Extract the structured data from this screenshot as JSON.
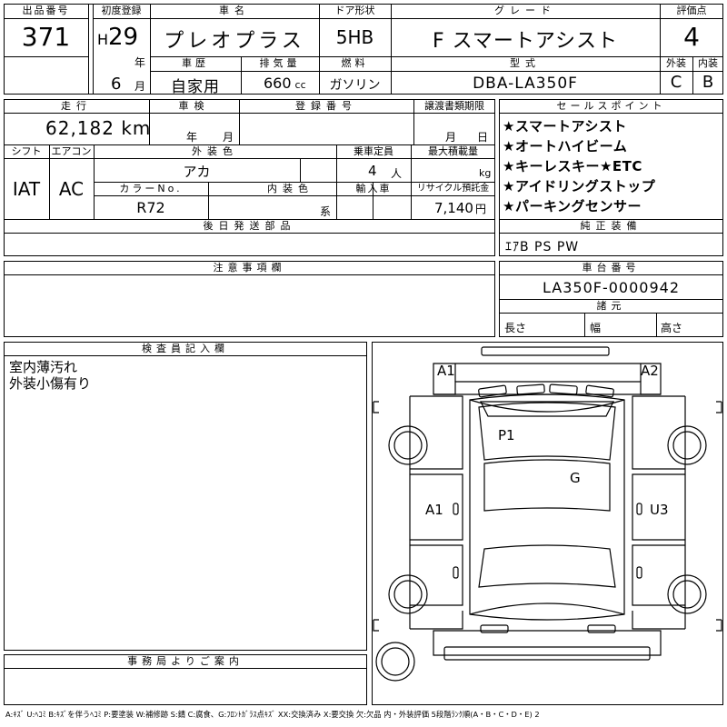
{
  "header": {
    "lot_label": "出品番号",
    "lot_no": "371",
    "reg_label": "初度登録",
    "era": "H",
    "year": "29",
    "year_unit": "年",
    "month": "6",
    "month_unit": "月",
    "name_label": "車名",
    "car_name": "プレオプラス",
    "door_label": "ドア形状",
    "door_type": "5HB",
    "grade_label": "グレード",
    "grade": "F スマートアシスト",
    "score_label": "評価点",
    "score": "4",
    "history_label": "車歴",
    "history": "自家用",
    "disp_label": "排気量",
    "displacement": "660",
    "disp_unit": "cc",
    "fuel_label": "燃料",
    "fuel": "ガソリン",
    "model_label": "型式",
    "model": "DBA-LA350F",
    "ext_label": "外装",
    "ext_grade": "C",
    "int_label": "内装",
    "int_grade": "B"
  },
  "row2": {
    "mileage_label": "走行",
    "mileage": "62,182",
    "mileage_unit": "km",
    "inspect_label": "車検",
    "inspect_year_unit": "年",
    "inspect_month_unit": "月",
    "regno_label": "登録番号",
    "transfer_label": "譲渡書類期限",
    "transfer_month_unit": "月",
    "transfer_day_unit": "日",
    "shift_label": "シフト",
    "shift": "IAT",
    "ac_label": "エアコン",
    "ac": "AC",
    "extcolor_label": "外装色",
    "ext_color": "アカ",
    "seats_label": "乗車定員",
    "seats": "4",
    "seats_unit": "人",
    "load_label": "最大積載量",
    "load_unit": "kg",
    "colorno_label": "カラーNo.",
    "color_no": "R72",
    "intcolor_label": "内装色",
    "int_color_unit": "系",
    "import_label": "輸入車",
    "recycle_label": "リサイクル預託金",
    "recycle": "7,140",
    "recycle_unit": "円",
    "later_parts_label": "後日発送部品"
  },
  "sales_points": {
    "label": "セールスポイント",
    "items": [
      "★スマートアシスト",
      "★オートハイビーム",
      "★キーレスキー★ETC",
      "★アイドリングストップ",
      "★パーキングセンサー"
    ]
  },
  "equipment": {
    "label": "純正装備",
    "value": "ｴｱB PS PW"
  },
  "notes": {
    "label": "注意事項欄"
  },
  "chassis": {
    "label": "車台番号",
    "value": "LA350F-0000942"
  },
  "dims": {
    "label": "諸元",
    "length": "長さ",
    "width": "幅",
    "height": "高さ"
  },
  "inspector": {
    "label": "検査員記入欄",
    "lines": [
      "室内薄汚れ",
      "外装小傷有り"
    ]
  },
  "office": {
    "label": "事務局よりご案内"
  },
  "diagram": {
    "marks": [
      "A1",
      "A2",
      "P1",
      "G",
      "A1",
      "U3"
    ]
  },
  "legend": "A:ｷｽﾞ U:ﾍｺﾐ B:ｷｽﾞを伴うﾍｺﾐ P:要塗装 W:補修跡 S:錆 C:腐食、G:ﾌﾛﾝﾄｶﾞﾗｽ点ｷｽﾞ XX:交換済み X:要交換 欠:欠品 内・外装評価 5段階ﾗﾝｸ順(A・B・C・D・E) 2"
}
